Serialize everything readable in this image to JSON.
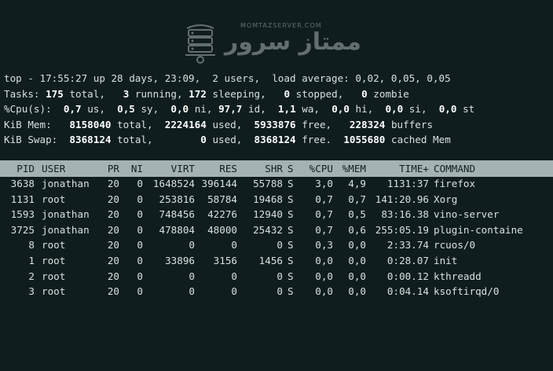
{
  "watermark": {
    "brand": "ممتاز سرور",
    "domain": "MOMTAZSERVER.COM"
  },
  "summary": {
    "line1": "top - 17:55:27 up 28 days, 23:09,  2 users,  load average: 0,02, 0,05, 0,05",
    "tasks": {
      "label": "Tasks:",
      "total": "175",
      "total_l": "total,",
      "running": "3",
      "running_l": "running,",
      "sleeping": "172",
      "sleeping_l": "sleeping,",
      "stopped": "0",
      "stopped_l": "stopped,",
      "zombie": "0",
      "zombie_l": "zombie"
    },
    "cpu": {
      "label": "%Cpu(s):",
      "us": "0,7",
      "us_l": "us,",
      "sy": "0,5",
      "sy_l": "sy,",
      "ni": "0,0",
      "ni_l": "ni,",
      "id": "97,7",
      "id_l": "id,",
      "wa": "1,1",
      "wa_l": "wa,",
      "hi": "0,0",
      "hi_l": "hi,",
      "si": "0,0",
      "si_l": "si,",
      "st": "0,0",
      "st_l": "st"
    },
    "mem": {
      "label": "KiB Mem:",
      "total": "8158040",
      "total_l": "total,",
      "used": "2224164",
      "used_l": "used,",
      "free": "5933876",
      "free_l": "free,",
      "buffers": "228324",
      "buffers_l": "buffers"
    },
    "swap": {
      "label": "KiB Swap:",
      "total": "8368124",
      "total_l": "total,",
      "used": "0",
      "used_l": "used,",
      "free": "8368124",
      "free_l": "free.",
      "cached": "1055680",
      "cached_l": "cached Mem"
    }
  },
  "table": {
    "columns": [
      "PID",
      "USER",
      "PR",
      "NI",
      "VIRT",
      "RES",
      "SHR",
      "S",
      "%CPU",
      "%MEM",
      "TIME+",
      "COMMAND"
    ],
    "rows": [
      [
        "3638",
        "jonathan",
        "20",
        "0",
        "1648524",
        "396144",
        "55788",
        "S",
        "3,0",
        "4,9",
        "1131:37",
        "firefox"
      ],
      [
        "1131",
        "root",
        "20",
        "0",
        "253816",
        "58784",
        "19468",
        "S",
        "0,7",
        "0,7",
        "141:20.96",
        "Xorg"
      ],
      [
        "1593",
        "jonathan",
        "20",
        "0",
        "748456",
        "42276",
        "12940",
        "S",
        "0,7",
        "0,5",
        "83:16.38",
        "vino-server"
      ],
      [
        "3725",
        "jonathan",
        "20",
        "0",
        "478804",
        "48000",
        "25432",
        "S",
        "0,7",
        "0,6",
        "255:05.19",
        "plugin-containe"
      ],
      [
        "8",
        "root",
        "20",
        "0",
        "0",
        "0",
        "0",
        "S",
        "0,3",
        "0,0",
        "2:33.74",
        "rcuos/0"
      ],
      [
        "1",
        "root",
        "20",
        "0",
        "33896",
        "3156",
        "1456",
        "S",
        "0,0",
        "0,0",
        "0:28.07",
        "init"
      ],
      [
        "2",
        "root",
        "20",
        "0",
        "0",
        "0",
        "0",
        "S",
        "0,0",
        "0,0",
        "0:00.12",
        "kthreadd"
      ],
      [
        "3",
        "root",
        "20",
        "0",
        "0",
        "0",
        "0",
        "S",
        "0,0",
        "0,0",
        "0:04.14",
        "ksoftirqd/0"
      ]
    ]
  }
}
